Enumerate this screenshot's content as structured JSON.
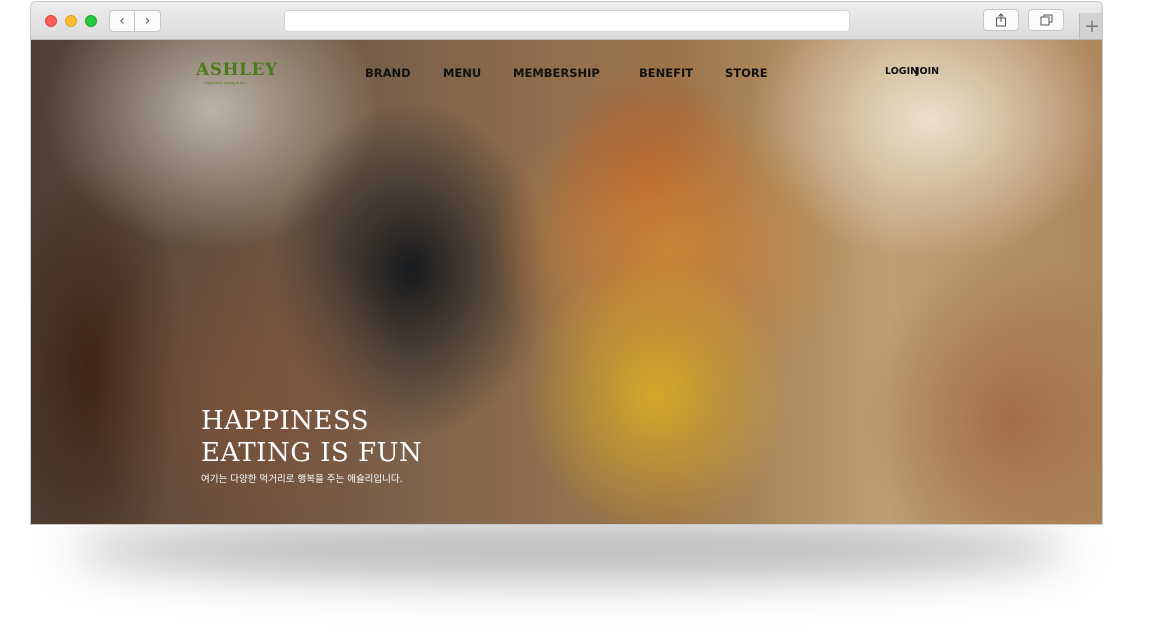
{
  "browser": {
    "back_icon": "chevron-left-icon",
    "forward_icon": "chevron-right-icon",
    "url": "",
    "share_icon": "share-icon",
    "tabs_icon": "tabs-overview-icon",
    "new_tab_icon": "plus-icon"
  },
  "site": {
    "logo": "ASHLEY",
    "logo_tagline": "Happiness eating is fun",
    "nav": [
      "BRAND",
      "MENU",
      "MEMBERSHIP",
      "BENEFIT",
      "STORE"
    ],
    "login": "LOGIN",
    "join": "JOIN"
  },
  "hero": {
    "title_line1": "HAPPINESS",
    "title_line2": "EATING IS FUN",
    "subtitle": "여기는 다양한 먹거리로 행복을 주는 애슐리입니다."
  }
}
